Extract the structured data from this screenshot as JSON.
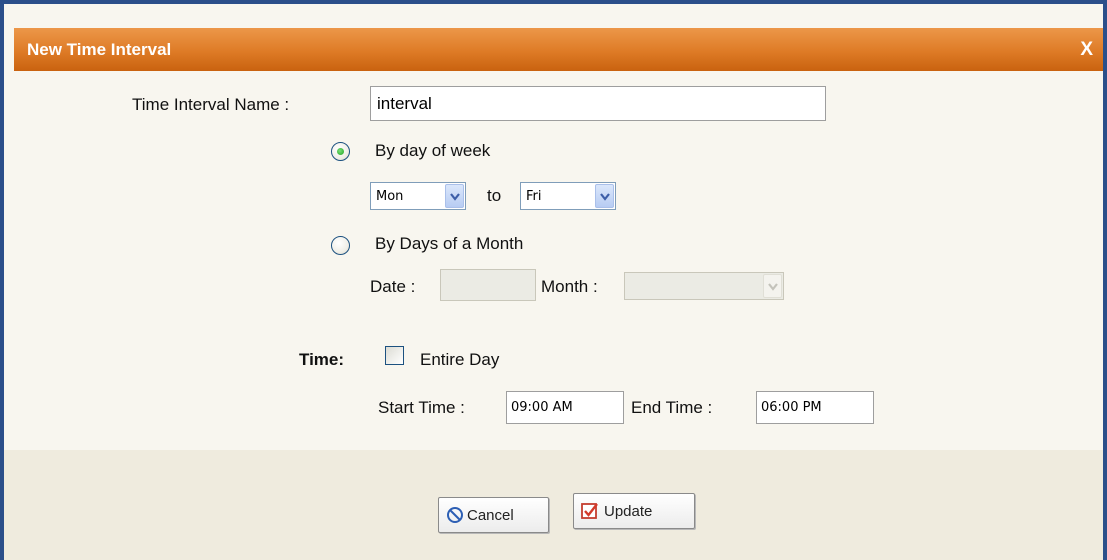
{
  "dialog": {
    "title": "New Time Interval",
    "close_label": "X"
  },
  "form": {
    "name_label": "Time Interval Name :",
    "name_value": "interval",
    "by_day_of_week": {
      "label": "By day of week",
      "selected": true,
      "from_value": "Mon",
      "to_label": "to",
      "to_value": "Fri"
    },
    "by_days_of_month": {
      "label": "By Days of a Month",
      "selected": false,
      "date_label": "Date :",
      "date_value": "",
      "month_label": "Month :",
      "month_value": ""
    },
    "time": {
      "label": "Time:",
      "entire_day_label": "Entire Day",
      "entire_day_checked": false,
      "start_label": "Start Time :",
      "start_value": "09:00 AM",
      "end_label": "End Time :",
      "end_value": "06:00 PM"
    }
  },
  "buttons": {
    "cancel_label": "Cancel",
    "update_label": "Update"
  },
  "colors": {
    "title_bar": "#de7b26",
    "dialog_border": "#2b4f8a",
    "body_bg": "#f8f6ef",
    "footer_bg": "#efebde"
  },
  "icons": {
    "cancel": "no-entry-icon",
    "update": "checkbox-check-icon",
    "radio_selected": "green-dot"
  }
}
